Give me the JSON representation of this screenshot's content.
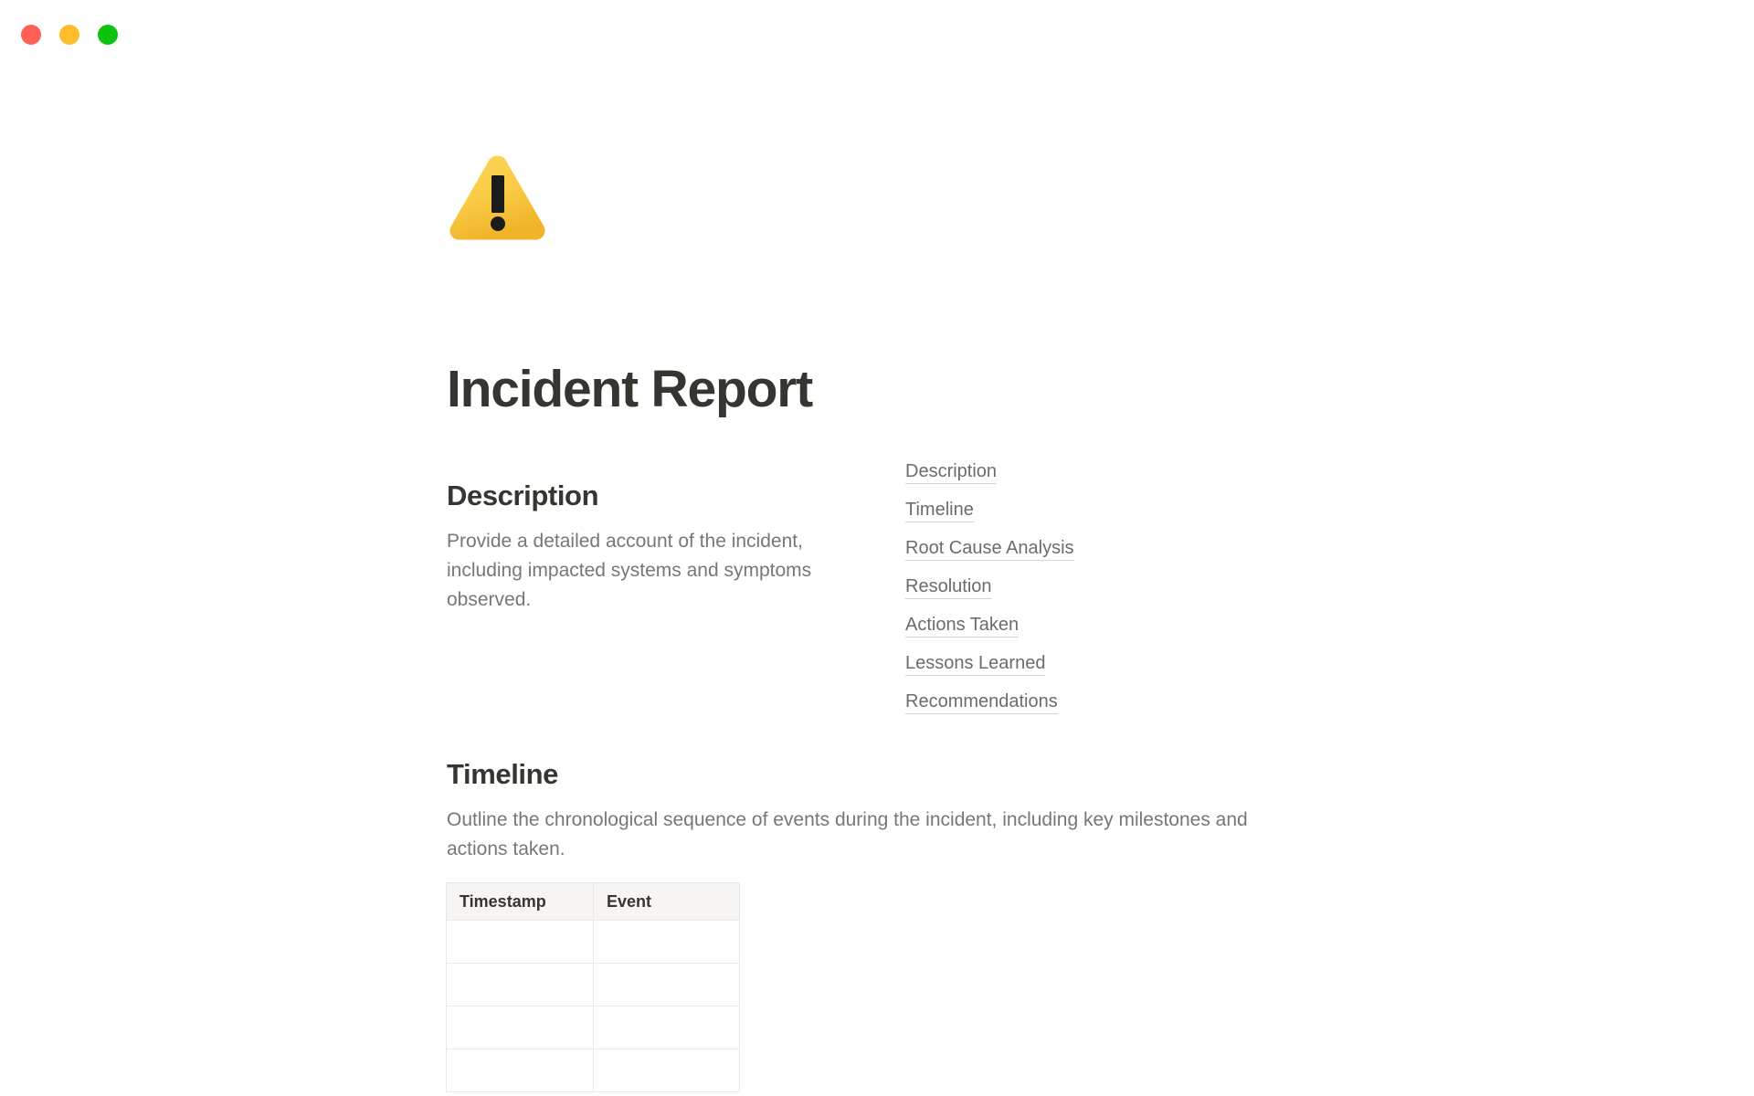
{
  "window": {
    "traffic_lights": [
      {
        "name": "close",
        "color": "#ff5f57"
      },
      {
        "name": "minimize",
        "color": "#ffbd2e"
      },
      {
        "name": "maximize",
        "color": "#0ec30e"
      }
    ]
  },
  "document": {
    "icon": "warning-triangle-emoji",
    "icon_colors": {
      "triangle": "#f7c948",
      "triangle_dark": "#f0b429",
      "mark": "#1f1f1f"
    },
    "title": "Incident Report",
    "title_color": "#37352f",
    "body_text_color": "#787774"
  },
  "description_section": {
    "heading": "Description",
    "body": "Provide a detailed account of the incident, including impacted systems and symptoms observed."
  },
  "toc": {
    "items": [
      {
        "label": "Description"
      },
      {
        "label": "Timeline"
      },
      {
        "label": "Root Cause Analysis"
      },
      {
        "label": "Resolution"
      },
      {
        "label": "Actions Taken"
      },
      {
        "label": "Lessons Learned"
      },
      {
        "label": "Recommendations"
      }
    ],
    "link_color": "#6c6c68",
    "underline_color": "#d6d5d2"
  },
  "timeline_section": {
    "heading": "Timeline",
    "body": "Outline the chronological sequence of events during the incident, including key milestones and actions taken.",
    "table": {
      "columns": [
        "Timestamp",
        "Event"
      ],
      "rows": [
        [
          "",
          ""
        ],
        [
          "",
          ""
        ],
        [
          "",
          ""
        ],
        [
          "",
          ""
        ]
      ],
      "header_background": "#f6f5f3",
      "border_color": "#e9e8e5"
    }
  }
}
